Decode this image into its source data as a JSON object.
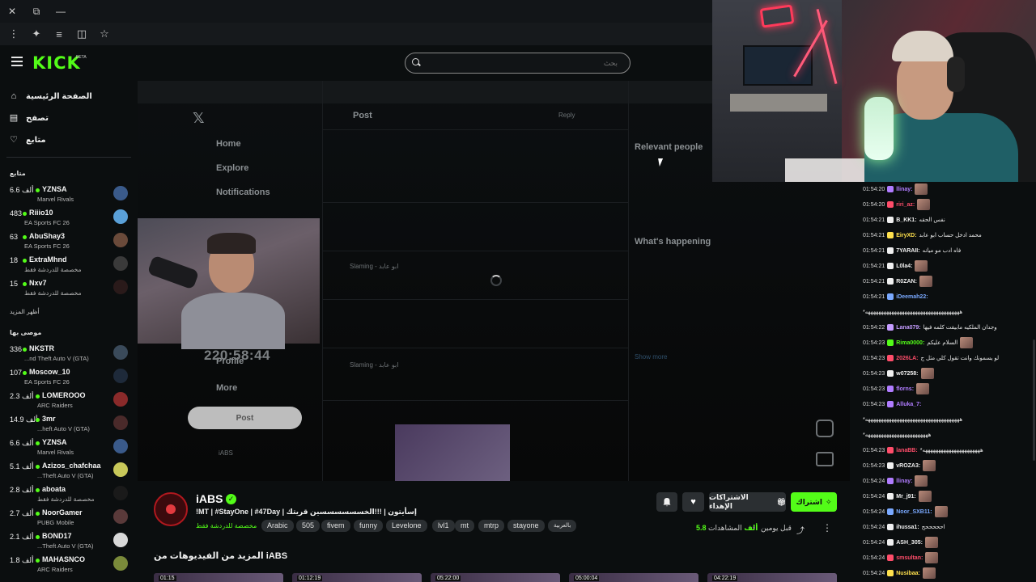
{
  "window": {
    "controls": [
      "⧉",
      "—"
    ]
  },
  "header": {
    "logo": "KICK",
    "logo_badge": "BETA",
    "search_placeholder": "بحث"
  },
  "sidebar": {
    "nav": [
      {
        "label": "الصفحة الرئيسية",
        "icon": "home-icon"
      },
      {
        "label": "تصفح",
        "icon": "browse-icon"
      },
      {
        "label": "متابع",
        "icon": "heart-icon"
      }
    ],
    "following_heading": "متابع",
    "following": [
      {
        "count": "6.6 ألف",
        "name": "YZNSA",
        "game": "Marvel Rivals"
      },
      {
        "count": "483",
        "name": "Riiio10",
        "game": "EA Sports FC 26"
      },
      {
        "count": "63",
        "name": "AbuShay3",
        "game": "EA Sports FC 26"
      },
      {
        "count": "18",
        "name": "ExtraMhnd",
        "game": "مخصصة للدردشة فقط"
      },
      {
        "count": "15",
        "name": "Nxv7",
        "game": "مخصصة للدردشة فقط"
      }
    ],
    "show_more": "أظهر المزيد",
    "recommended_heading": "موصى بها",
    "recommended": [
      {
        "count": "336",
        "name": "NKSTR",
        "game": "...nd Theft Auto V (GTA)"
      },
      {
        "count": "107",
        "name": "Moscow_10",
        "game": "EA Sports FC 26"
      },
      {
        "count": "2.3 ألف",
        "name": "LOMEROOO",
        "game": "ARC Raiders"
      },
      {
        "count": "14.9 ألف",
        "name": "3mr",
        "game": "...heft Auto V (GTA)"
      },
      {
        "count": "6.6 ألف",
        "name": "YZNSA",
        "game": "Marvel Rivals"
      },
      {
        "count": "5.1 ألف",
        "name": "Azizos_chafchaa",
        "game": "...Theft Auto V (GTA)"
      },
      {
        "count": "2.8 ألف",
        "name": "aboata",
        "game": "مخصصة للدردشة فقط"
      },
      {
        "count": "2.7 ألف",
        "name": "NoorGamer",
        "game": "PUBG Mobile"
      },
      {
        "count": "2.1 ألف",
        "name": "BOND17",
        "game": "...Theft Auto V (GTA)"
      },
      {
        "count": "1.8 ألف",
        "name": "MAHASNCO",
        "game": "ARC Raiders"
      }
    ]
  },
  "player": {
    "x_nav": [
      "Home",
      "Explore",
      "Notifications"
    ],
    "x_post_header": "Post",
    "x_reply": "Reply",
    "x_profile": "Profile",
    "x_more": "More",
    "x_post_button": "Post",
    "x_relevant": "Relevant people",
    "x_happening": "What's happening",
    "x_show_more": "Show more",
    "x_handle": "Slaming - ابو عابد",
    "x_profile_name": "iABS",
    "timer": "220:58:44"
  },
  "chat": {
    "messages": [
      {
        "time": "01:54:20",
        "user": "llinay:",
        "color": "#b07cff",
        "msg": "",
        "emote": true
      },
      {
        "time": "01:54:20",
        "user": "riri_az:",
        "color": "#ff4d6a",
        "msg": "",
        "emote": true
      },
      {
        "time": "01:54:21",
        "user": "B_KK1:",
        "color": "#f0f0f0",
        "msg": "نفس الحقه"
      },
      {
        "time": "01:54:21",
        "user": "EiryXD:",
        "color": "#ffe14d",
        "msg": "محمد ادخل حساب ابو عابد"
      },
      {
        "time": "01:54:21",
        "user": "7YARAII:",
        "color": "#f0f0f0",
        "msg": "فاه ادب مو ميانه"
      },
      {
        "time": "01:54:21",
        "user": "L0la4:",
        "color": "#f0f0f0",
        "msg": "",
        "emote": true
      },
      {
        "time": "01:54:21",
        "user": "R0ZAN:",
        "color": "#f0f0f0",
        "msg": "",
        "emote": true
      },
      {
        "time": "01:54:21",
        "user": "iDeemah22:",
        "color": "#7aa9ff",
        "msg": ""
      },
      {
        "time": "",
        "user": "",
        "color": "#f0f0f0",
        "msg": "*ههههههههههههههههههههههههههههههههههههه"
      },
      {
        "time": "01:54:22",
        "user": "Lana079:",
        "color": "#c59cff",
        "msg": "وجدان الملكيه مابيقت كلمه فيها"
      },
      {
        "time": "01:54:23",
        "user": "Rima0000:",
        "color": "#53fc18",
        "msg": "السلام عليكم",
        "emote": true
      },
      {
        "time": "01:54:23",
        "user": "2026LA:",
        "color": "#ff4d6a",
        "msg": "لو يسمونك وانت تقول كلي مثل ج"
      },
      {
        "time": "01:54:23",
        "user": "w07258:",
        "color": "#f0f0f0",
        "msg": "",
        "emote": true
      },
      {
        "time": "01:54:23",
        "user": "florns:",
        "color": "#b07cff",
        "msg": "",
        "emote": true
      },
      {
        "time": "01:54:23",
        "user": "Alluka_7:",
        "color": "#b07cff",
        "msg": ""
      },
      {
        "time": "",
        "user": "",
        "color": "#f0f0f0",
        "msg": "*ههههههههههههههههههههههههههههههههههههه"
      },
      {
        "time": "",
        "user": "",
        "color": "#f0f0f0",
        "msg": "*ههههههههههههههههههههههههه"
      },
      {
        "time": "01:54:23",
        "user": "lanaBB:",
        "color": "#ff4d6a",
        "msg": "*ههههههههههههههههههههههه"
      },
      {
        "time": "01:54:23",
        "user": "vROZA3:",
        "color": "#f0f0f0",
        "msg": "",
        "emote": true
      },
      {
        "time": "01:54:24",
        "user": "llinay:",
        "color": "#b07cff",
        "msg": "",
        "emote": true
      },
      {
        "time": "01:54:24",
        "user": "Mr_j91:",
        "color": "#f0f0f0",
        "msg": "",
        "emote": true
      },
      {
        "time": "01:54:24",
        "user": "Noor_SXB11:",
        "color": "#7aa9ff",
        "msg": "",
        "emote": true
      },
      {
        "time": "01:54:24",
        "user": "ihussa1:",
        "color": "#f0f0f0",
        "msg": "احححححح"
      },
      {
        "time": "01:54:24",
        "user": "ASH_305:",
        "color": "#f0f0f0",
        "msg": "",
        "emote": true
      },
      {
        "time": "01:54:24",
        "user": "smsultan:",
        "color": "#ff4d6a",
        "msg": "",
        "emote": true
      },
      {
        "time": "01:54:24",
        "user": "Nusibaa:",
        "color": "#ffe14d",
        "msg": "",
        "emote": true
      }
    ]
  },
  "stream": {
    "channel": "iABS",
    "title": "!MT | #StayOne | #47Day | إسأيتون | !!!الخسسسسسسين قريتك",
    "category": "مخصصة للدردشة فقط",
    "tags": [
      "Arabic",
      "505",
      "fivem",
      "funny",
      "Levelone",
      "lvl1",
      "mt",
      "mtrp",
      "stayone",
      "بالعربية"
    ],
    "gift_label": "الاشتراكات الإهداء",
    "subscribe_label": "اشتراك",
    "views_label": "المشاهدات",
    "views_value": "5.8 ألف",
    "ago": "قبل يومين",
    "more_videos": "المزيد من الفيديوهات من iABS",
    "thumbs": [
      "01:15",
      "01:12:19",
      "05:22:00",
      "05:00:04",
      "04:22:19"
    ]
  }
}
